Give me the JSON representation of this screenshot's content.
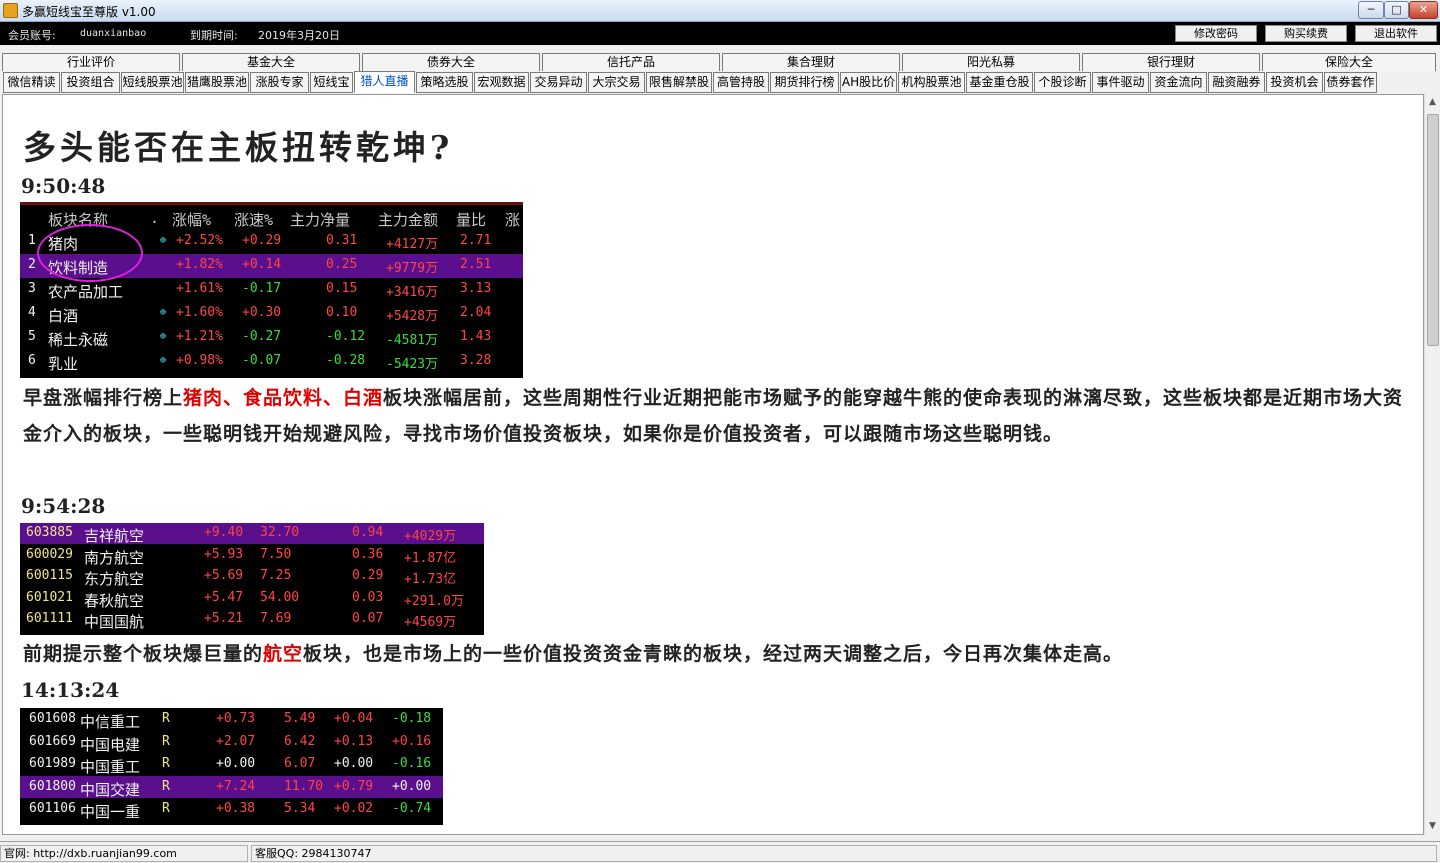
{
  "window": {
    "title": "多赢短线宝至尊版 v1.00"
  },
  "account": {
    "member_label": "会员账号:",
    "member_value": "duanxianbao",
    "expire_label": "到期时间:",
    "expire_value": "2019年3月20日"
  },
  "buttons": {
    "change_password": "修改密码",
    "renew": "购买续费",
    "exit": "退出软件"
  },
  "categories": [
    "行业评价",
    "基金大全",
    "债券大全",
    "信托产品",
    "集合理财",
    "阳光私募",
    "银行理财",
    "保险大全"
  ],
  "tabs": [
    "微信精读",
    "投资组合",
    "短线股票池",
    "猎鹰股票池",
    "涨股专家",
    "短线宝",
    "猎人直播",
    "策略选股",
    "宏观数据",
    "交易异动",
    "大宗交易",
    "限售解禁股",
    "高管持股",
    "期货排行榜",
    "AH股比价",
    "机构股票池",
    "基金重仓股",
    "个股诊断",
    "事件驱动",
    "资金流向",
    "融资融券",
    "投资机会",
    "债券套作"
  ],
  "active_tab": "猎人直播",
  "article": {
    "title": "多头能否在主板扭转乾坤?",
    "time1": "9:50:48",
    "table1": {
      "headers": [
        "板块名称",
        ".",
        "涨幅%",
        "涨速%",
        "主力净量",
        "主力金额",
        "量比",
        "涨"
      ],
      "rows": [
        {
          "no": "1",
          "name": "猪肉",
          "rise": "+2.52%",
          "speed": "+0.29",
          "net": "0.31",
          "amount": "+4127万",
          "ratio": "2.71"
        },
        {
          "no": "2",
          "name": "饮料制造",
          "rise": "+1.82%",
          "speed": "+0.14",
          "net": "0.25",
          "amount": "+9779万",
          "ratio": "2.51"
        },
        {
          "no": "3",
          "name": "农产品加工",
          "rise": "+1.61%",
          "speed": "-0.17",
          "net": "0.15",
          "amount": "+3416万",
          "ratio": "3.13"
        },
        {
          "no": "4",
          "name": "白酒",
          "rise": "+1.60%",
          "speed": "+0.30",
          "net": "0.10",
          "amount": "+5428万",
          "ratio": "2.04"
        },
        {
          "no": "5",
          "name": "稀土永磁",
          "rise": "+1.21%",
          "speed": "-0.27",
          "net": "-0.12",
          "amount": "-4581万",
          "ratio": "1.43"
        },
        {
          "no": "6",
          "name": "乳业",
          "rise": "+0.98%",
          "speed": "-0.07",
          "net": "-0.28",
          "amount": "-5423万",
          "ratio": "3.28"
        }
      ]
    },
    "para1_a": "早盘涨幅排行榜上",
    "para1_hl1": "猪肉、食品饮料、白酒",
    "para1_b": "板块涨幅居前，这些周期性行业近期把能市场赋予的能穿越牛熊的使命表现的淋漓尽致，这些板块都是近期市场大资金介入的板块，一些聪明钱开始规避风险，寻找市场价值投资板块，如果你是价值投资者，可以跟随市场这些聪明钱。",
    "time2": "9:54:28",
    "table2": [
      {
        "code": "603885",
        "name": "吉祥航空",
        "rise": "+9.40",
        "price": "32.70",
        "net": "0.94",
        "amount": "+4029万"
      },
      {
        "code": "600029",
        "name": "南方航空",
        "rise": "+5.93",
        "price": "7.50",
        "net": "0.36",
        "amount": "+1.87亿"
      },
      {
        "code": "600115",
        "name": "东方航空",
        "rise": "+5.69",
        "price": "7.25",
        "net": "0.29",
        "amount": "+1.73亿"
      },
      {
        "code": "601021",
        "name": "春秋航空",
        "rise": "+5.47",
        "price": "54.00",
        "net": "0.03",
        "amount": "+291.0万"
      },
      {
        "code": "601111",
        "name": "中国国航",
        "rise": "+5.21",
        "price": "7.69",
        "net": "0.07",
        "amount": "+4569万"
      }
    ],
    "para2_a": "前期提示整个板块爆巨量的",
    "para2_hl": "航空",
    "para2_b": "板块，也是市场上的一些价值投资资金青睐的板块，经过两天调整之后，今日再次集体走高。",
    "time3": "14:13:24",
    "table3": [
      {
        "code": "601608",
        "name": "中信重工",
        "flag": "R",
        "rise": "+0.73",
        "price": "5.49",
        "speed": "+0.04",
        "net": "-0.18"
      },
      {
        "code": "601669",
        "name": "中国电建",
        "flag": "R",
        "rise": "+2.07",
        "price": "6.42",
        "speed": "+0.13",
        "net": "+0.16"
      },
      {
        "code": "601989",
        "name": "中国重工",
        "flag": "R",
        "rise": "+0.00",
        "price": "6.07",
        "speed": "+0.00",
        "net": "-0.16"
      },
      {
        "code": "601800",
        "name": "中国交建",
        "flag": "R",
        "rise": "+7.24",
        "price": "11.70",
        "speed": "+0.79",
        "net": "+0.00"
      },
      {
        "code": "601106",
        "name": "中国一重",
        "flag": "R",
        "rise": "+0.38",
        "price": "5.34",
        "speed": "+0.02",
        "net": "-0.74"
      }
    ]
  },
  "status": {
    "website": "官网: http://dxb.ruanjian99.com",
    "qq": "客服QQ: 2984130747"
  }
}
